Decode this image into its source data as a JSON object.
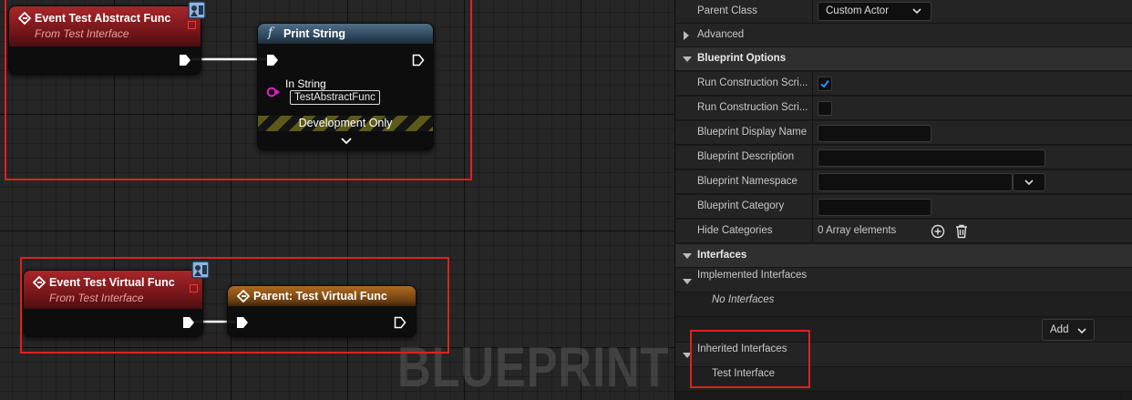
{
  "graph": {
    "watermark": "BLUEPRINT",
    "node_abstract": {
      "title": "Event Test Abstract Func",
      "subtitle": "From Test Interface"
    },
    "node_print": {
      "title": "Print String",
      "func_glyph": "f",
      "pin_in_string": "In String",
      "in_string_value": "TestAbstractFunc",
      "dev_only": "Development Only"
    },
    "node_virtual": {
      "title": "Event Test Virtual Func",
      "subtitle": "From Test Interface"
    },
    "node_parent": {
      "title": "Parent: Test Virtual Func"
    },
    "colors": {
      "highlight": "#e02020",
      "event_header": "#8b1d22",
      "function_header": "#3a566c",
      "parent_header": "#8a521a",
      "string_pin": "#e020c8"
    }
  },
  "details": {
    "parent_class": {
      "label": "Parent Class",
      "value": "Custom Actor"
    },
    "advanced": {
      "label": "Advanced"
    },
    "blueprint_options": {
      "title": "Blueprint Options",
      "run_cs_1": {
        "label": "Run Construction Scri...",
        "checked": true
      },
      "run_cs_2": {
        "label": "Run Construction Scri...",
        "checked": false
      },
      "display_name": {
        "label": "Blueprint Display Name",
        "value": ""
      },
      "description": {
        "label": "Blueprint Description",
        "value": ""
      },
      "namespace": {
        "label": "Blueprint Namespace",
        "value": ""
      },
      "category": {
        "label": "Blueprint Category",
        "value": ""
      },
      "hide_categories": {
        "label": "Hide Categories",
        "value": "0 Array elements"
      }
    },
    "interfaces": {
      "title": "Interfaces",
      "implemented_label": "Implemented Interfaces",
      "no_interfaces": "No Interfaces",
      "add_button": "Add",
      "inherited_label": "Inherited Interfaces",
      "inherited_item": "Test Interface"
    }
  }
}
